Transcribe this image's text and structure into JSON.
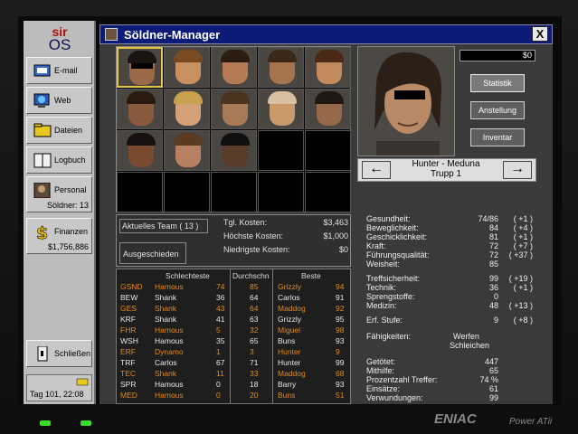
{
  "os": {
    "logo_top": "sir",
    "logo_bottom": "OS"
  },
  "sidebar": {
    "items": [
      {
        "label": "E-mail",
        "icon": "mail-icon"
      },
      {
        "label": "Web",
        "icon": "globe-icon"
      },
      {
        "label": "Dateien",
        "icon": "folder-icon"
      },
      {
        "label": "Logbuch",
        "icon": "book-icon"
      },
      {
        "label": "Personal",
        "icon": "person-icon"
      },
      {
        "label": "Finanzen",
        "icon": "dollar-icon"
      },
      {
        "label": "Schließen",
        "icon": "exit-icon"
      }
    ],
    "soldiers_text": "Söldner: 13",
    "finance_amount": "$1,756,886",
    "clock": "Tag 101, 22:08"
  },
  "window": {
    "title": "Söldner-Manager",
    "close_label": "X"
  },
  "team": {
    "current_team_label": "Aktuelles Team ( 13 )",
    "retired_label": "Ausgeschieden",
    "costs": [
      {
        "label": "Tgl. Kosten:",
        "value": "$3,463"
      },
      {
        "label": "Höchste Kosten:",
        "value": "$1,000"
      },
      {
        "label": "Niedrigste Kosten:",
        "value": "$0"
      }
    ]
  },
  "stats_table": {
    "headers": [
      "Schlechteste",
      "Durchschn",
      "Beste"
    ],
    "rows": [
      {
        "attr": "GSND",
        "worst": "Hamous",
        "worst_v": "74",
        "avg": "85",
        "best": "Grizzly",
        "best_v": "94",
        "hl": true
      },
      {
        "attr": "BEW",
        "worst": "Shank",
        "worst_v": "36",
        "avg": "64",
        "best": "Carlos",
        "best_v": "91",
        "hl": false
      },
      {
        "attr": "GES",
        "worst": "Shank",
        "worst_v": "43",
        "avg": "64",
        "best": "Maddog",
        "best_v": "92",
        "hl": true
      },
      {
        "attr": "KRF",
        "worst": "Shank",
        "worst_v": "41",
        "avg": "63",
        "best": "Grizzly",
        "best_v": "95",
        "hl": false
      },
      {
        "attr": "FHR",
        "worst": "Hamous",
        "worst_v": "5",
        "avg": "32",
        "best": "Miguel",
        "best_v": "98",
        "hl": true
      },
      {
        "attr": "WSH",
        "worst": "Hamous",
        "worst_v": "35",
        "avg": "65",
        "best": "Buns",
        "best_v": "93",
        "hl": false
      },
      {
        "attr": "ERF",
        "worst": "Dynamo",
        "worst_v": "1",
        "avg": "3",
        "best": "Hunter",
        "best_v": "9",
        "hl": true
      },
      {
        "attr": "TRF",
        "worst": "Carlos",
        "worst_v": "67",
        "avg": "71",
        "best": "Hunter",
        "best_v": "99",
        "hl": false
      },
      {
        "attr": "TEC",
        "worst": "Shank",
        "worst_v": "11",
        "avg": "33",
        "best": "Maddog",
        "best_v": "68",
        "hl": true
      },
      {
        "attr": "SPR",
        "worst": "Hamous",
        "worst_v": "0",
        "avg": "18",
        "best": "Barry",
        "best_v": "93",
        "hl": false
      },
      {
        "attr": "MED",
        "worst": "Hamous",
        "worst_v": "0",
        "avg": "20",
        "best": "Buns",
        "best_v": "51",
        "hl": true
      }
    ]
  },
  "merc": {
    "balance": "$0",
    "name_line": "Hunter - Meduna",
    "squad_line": "Trupp 1",
    "buttons": [
      "Statistik",
      "Anstellung",
      "Inventar"
    ],
    "attributes": [
      {
        "label": "Gesundheit:",
        "value": "74/86",
        "bonus": "( +1 )"
      },
      {
        "label": "Beweglichkeit:",
        "value": "84",
        "bonus": "( +4 )"
      },
      {
        "label": "Geschicklichkeit:",
        "value": "81",
        "bonus": "( +1 )"
      },
      {
        "label": "Kraft:",
        "value": "72",
        "bonus": "( +7 )"
      },
      {
        "label": "Führungsqualität:",
        "value": "72",
        "bonus": "( +37 )"
      },
      {
        "label": "Weisheit:",
        "value": "85",
        "bonus": ""
      },
      {
        "label": "Treffsicherheit:",
        "value": "99",
        "bonus": "( +19 )"
      },
      {
        "label": "Technik:",
        "value": "36",
        "bonus": "( +1 )"
      },
      {
        "label": "Sprengstoffe:",
        "value": "0",
        "bonus": ""
      },
      {
        "label": "Medizin:",
        "value": "48",
        "bonus": "( +13 )"
      },
      {
        "label": "Erf. Stufe:",
        "value": "9",
        "bonus": "( +8 )"
      }
    ],
    "skills_label": "Fähigkeiten:",
    "skills": [
      "Werfen",
      "Schleichen"
    ],
    "records": [
      {
        "label": "Getötet:",
        "value": "447"
      },
      {
        "label": "Mithilfe:",
        "value": "65"
      },
      {
        "label": "Prozentzahl Treffer:",
        "value": "74 %"
      },
      {
        "label": "Einsätze:",
        "value": "61"
      },
      {
        "label": "Verwundungen:",
        "value": "99"
      }
    ]
  },
  "footer": {
    "brand": "ENIAC",
    "model": "Power ATii"
  }
}
